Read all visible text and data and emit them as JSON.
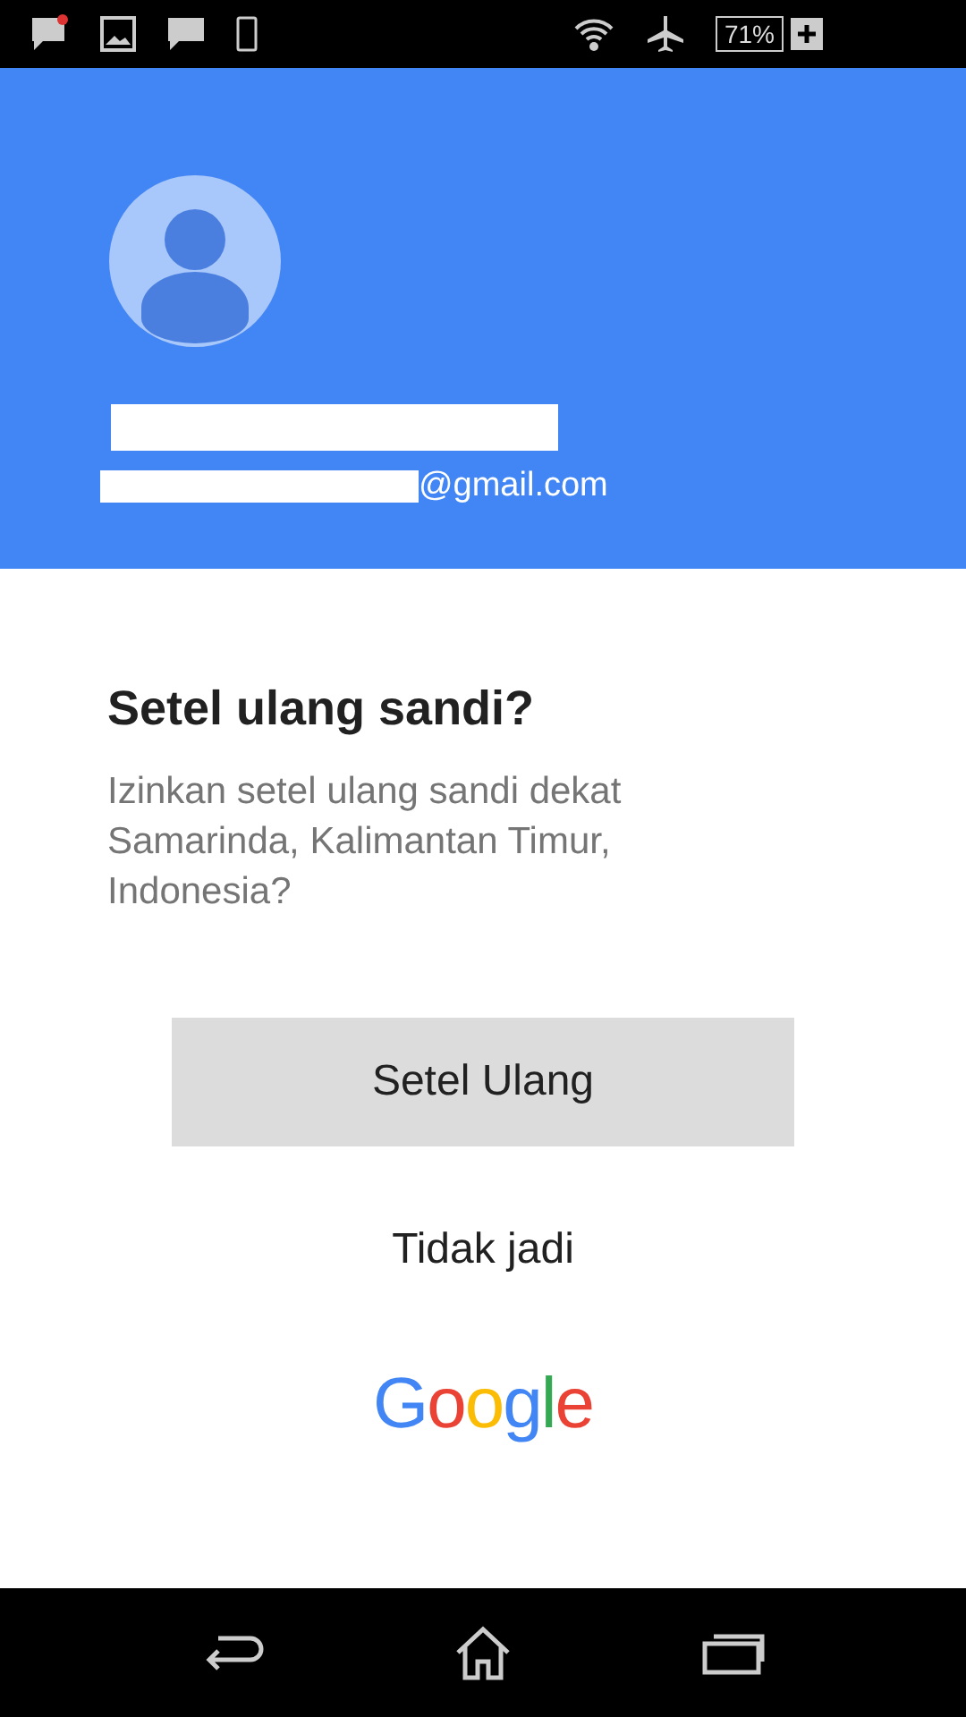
{
  "status_bar": {
    "battery": "71%"
  },
  "account": {
    "email_suffix": "@gmail.com"
  },
  "dialog": {
    "title": "Setel ulang sandi?",
    "message": "Izinkan setel ulang sandi dekat Samarinda, Kalimantan Timur, Indonesia?"
  },
  "buttons": [
    {
      "label": "Setel Ulang",
      "kind": "filled"
    },
    {
      "label": "Tidak jadi",
      "kind": "text"
    }
  ],
  "logo": "Google"
}
